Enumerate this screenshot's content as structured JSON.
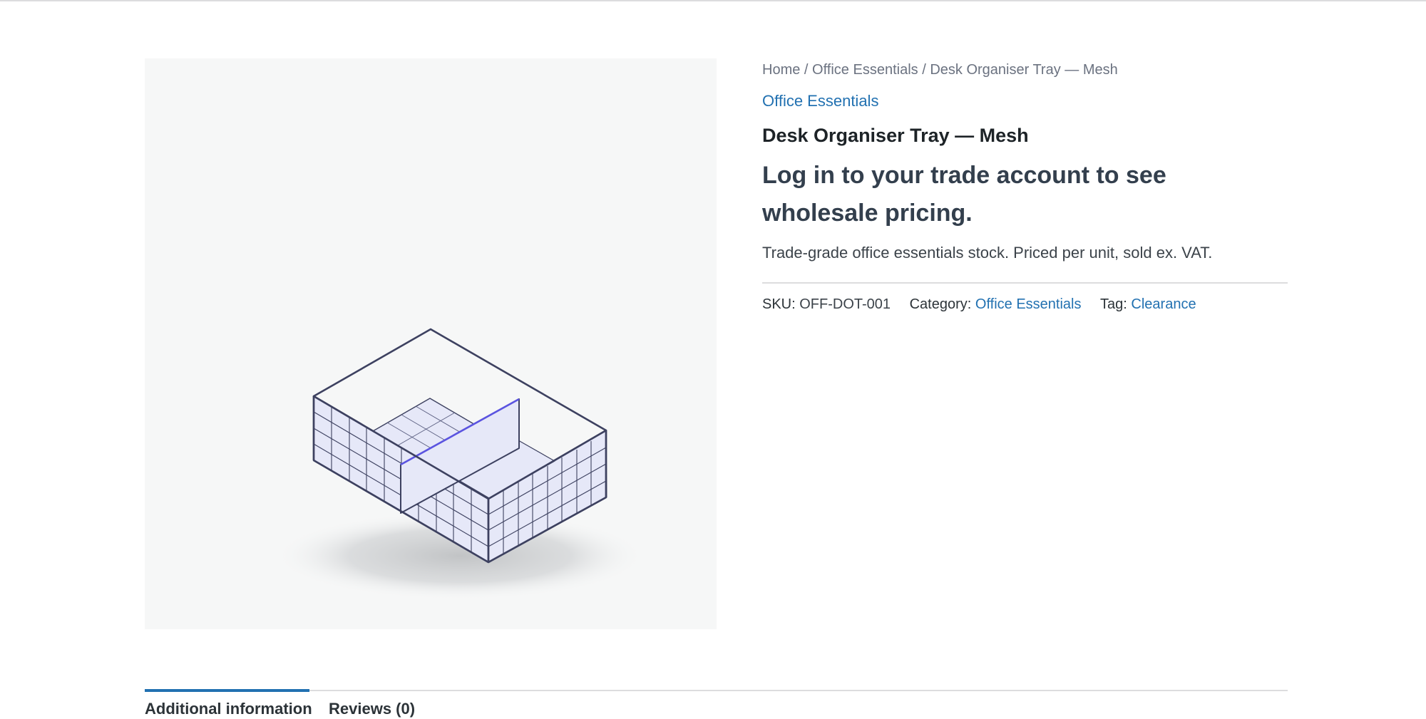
{
  "breadcrumb": {
    "items": [
      "Home",
      "Office Essentials",
      "Desk Organiser Tray — Mesh"
    ],
    "separator": "/"
  },
  "product": {
    "category_label": "Office Essentials",
    "title": "Desk Organiser Tray — Mesh",
    "price_notice": "Log in to your trade account to see wholesale pricing.",
    "short_description": "Trade-grade office essentials stock. Priced per unit, sold ex. VAT.",
    "image_alt_icon": "mesh-desk-tray-illustration"
  },
  "meta": {
    "sku_label": "SKU:",
    "sku_value": "OFF-DOT-001",
    "category_label": "Category:",
    "category_value": "Office Essentials",
    "tag_label": "Tag:",
    "tag_value": "Clearance"
  },
  "tabs": [
    {
      "label": "Additional information",
      "active": true
    },
    {
      "label": "Reviews (0)",
      "active": false
    }
  ],
  "colors": {
    "link": "#2271b1",
    "heading": "#333f4d",
    "image_bg": "#f6f7f7",
    "tray_fill": "#e6e8f8",
    "tray_stroke": "#3d4160",
    "divider_accent": "#5b54e0"
  }
}
